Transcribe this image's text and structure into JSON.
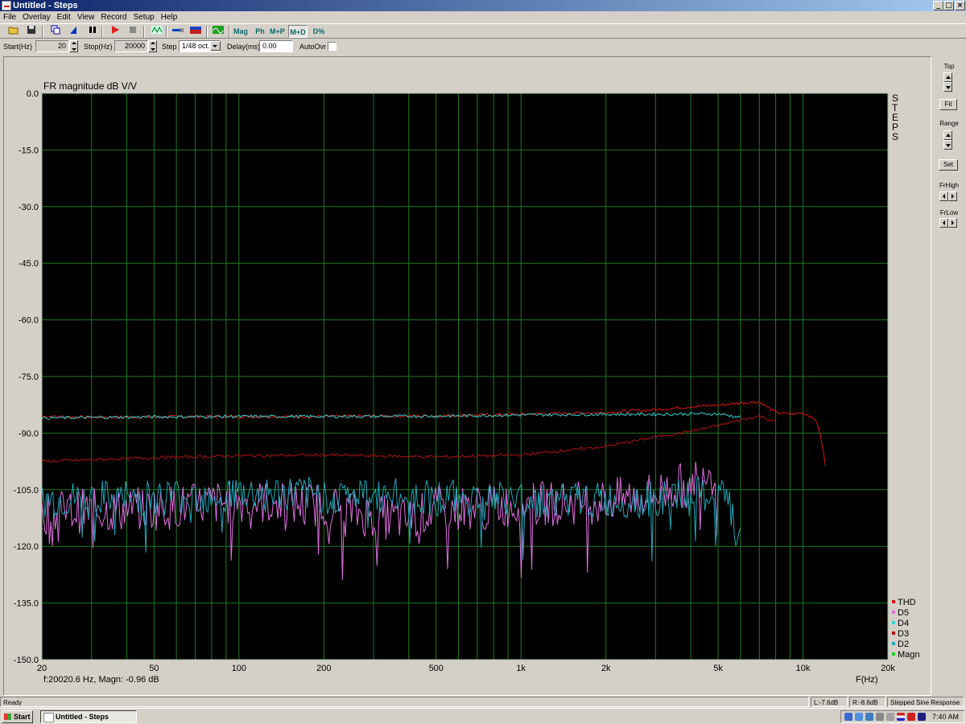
{
  "window": {
    "title": "Untitled - Steps"
  },
  "menu": [
    "File",
    "Overlay",
    "Edit",
    "View",
    "Record",
    "Setup",
    "Help"
  ],
  "toolbar": {
    "mag": "Mag",
    "ph": "Ph",
    "mp": "M+P",
    "md": "M+D",
    "dpct": "D%",
    "icons": [
      "open-icon",
      "save-icon",
      "copy-icon",
      "marker-icon",
      "pause-icon",
      "run-icon",
      "stop-icon",
      "wave-icon",
      "probe-icon",
      "generator-icon",
      "scope-icon"
    ]
  },
  "params": {
    "start_label": "Start(Hz)",
    "start_value": "20",
    "stop_label": "Stop(Hz)",
    "stop_value": "20000",
    "step_label": "Step",
    "step_value": "1/48 oct.",
    "delay_label": "Delay(ms)",
    "delay_value": "0.00",
    "autoovr_label": "AutoOvr"
  },
  "right_panel": {
    "top": "Top",
    "fit": "Fit",
    "range": "Range",
    "set": "Set",
    "frhigh": "FrHigh",
    "frlow": "FrLow"
  },
  "status": {
    "ready": "Ready",
    "left": "L:-7.6dB",
    "right": "R:-8.6dB",
    "mode": "Stepped Sine Response"
  },
  "taskbar": {
    "start": "Start",
    "task": "Untitled - Steps",
    "clock": "7:40 AM"
  },
  "chart_data": {
    "type": "line",
    "title": "FR magnitude dB V/V",
    "xlabel": "F(Hz)",
    "side_label": "STEPS",
    "cursor_readout": "f:20020.6 Hz, Magn: -0.96 dB",
    "x_scale": "log",
    "xlim": [
      20,
      20000
    ],
    "ylim": [
      -150,
      0
    ],
    "y_ticks": [
      0,
      -15,
      -30,
      -45,
      -60,
      -75,
      -90,
      -105,
      -120,
      -135,
      -150
    ],
    "y_tick_labels": [
      "0.0",
      "-15.0",
      "-30.0",
      "-45.0",
      "-60.0",
      "-75.0",
      "-90.0",
      "-105.0",
      "-120.0",
      "-135.0",
      "-150.0"
    ],
    "x_ticks": [
      20,
      50,
      100,
      200,
      500,
      1000,
      2000,
      5000,
      10000,
      20000
    ],
    "x_tick_labels": [
      "20",
      "50",
      "100",
      "200",
      "500",
      "1k",
      "2k",
      "5k",
      "10k",
      "20k"
    ],
    "grid": true,
    "legend_position": "bottom-right",
    "background": "#000000",
    "grid_color": "#1f7a1f",
    "series": [
      {
        "name": "THD",
        "color": "#e01010",
        "x": [
          20,
          30,
          50,
          100,
          200,
          500,
          1000,
          2000,
          3000,
          4000,
          5000,
          6000,
          7000,
          8000,
          9000,
          10000,
          11000,
          11500,
          12000
        ],
        "y": [
          -85.5,
          -85.8,
          -85.7,
          -85.6,
          -85.6,
          -85.4,
          -85.0,
          -84.5,
          -83.8,
          -83.0,
          -82.6,
          -82.0,
          -81.7,
          -84.5,
          -85.0,
          -84.7,
          -86.0,
          -90.0,
          -98.5
        ]
      },
      {
        "name": "D5",
        "color": "#e070e0",
        "x": [
          20,
          50,
          100,
          200,
          300,
          400,
          500,
          1000,
          2000,
          3000,
          4000,
          4500,
          5000
        ],
        "y": [
          -111,
          -110,
          -108,
          -109,
          -112,
          -113,
          -110,
          -109,
          -108,
          -106,
          -103,
          -99,
          -102
        ],
        "noise": 6
      },
      {
        "name": "D4",
        "color": "#30d0d0",
        "x": [
          20,
          50,
          100,
          200,
          500,
          1000,
          2000,
          3000,
          4000,
          5000,
          6000
        ],
        "y": [
          -86,
          -85.7,
          -85.6,
          -85.6,
          -85.5,
          -85.2,
          -85.0,
          -85.0,
          -84.9,
          -84.9,
          -85.8
        ]
      },
      {
        "name": "D3",
        "color": "#b01010",
        "x": [
          20,
          50,
          100,
          200,
          500,
          1000,
          2000,
          3000,
          4000,
          5000,
          6000,
          7000,
          8000
        ],
        "y": [
          -97.5,
          -96.5,
          -96.0,
          -95.8,
          -96.3,
          -95.8,
          -93.5,
          -91.0,
          -89.5,
          -88.0,
          -86.5,
          -85.5,
          -87.0
        ]
      },
      {
        "name": "D2",
        "color": "#20a8b8",
        "x": [
          20,
          50,
          100,
          200,
          500,
          1000,
          2000,
          3000,
          4000,
          5000,
          5500,
          6000
        ],
        "y": [
          -108,
          -107,
          -106,
          -106.5,
          -107,
          -107.5,
          -108,
          -107.5,
          -107,
          -106.5,
          -110,
          -120
        ],
        "noise": 5
      },
      {
        "name": "Magn",
        "color": "#20d020",
        "x": [],
        "y": []
      }
    ]
  }
}
